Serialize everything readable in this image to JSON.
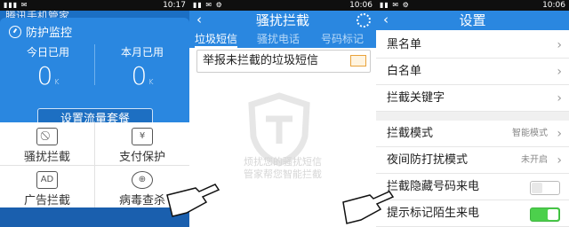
{
  "status": {
    "s1_time": "10:17",
    "s2_time": "10:06",
    "s3_time": "10:06"
  },
  "screen1": {
    "header": "腾讯手机管家",
    "card_title": "防护监控",
    "today_label": "今日已用",
    "today_value": "0",
    "today_unit": "K",
    "month_label": "本月已用",
    "month_value": "0",
    "month_unit": "K",
    "plan_button": "设置流量套餐",
    "grid": [
      {
        "label": "骚扰拦截",
        "icon": "block-icon"
      },
      {
        "label": "支付保护",
        "icon": "yen-shield-icon"
      },
      {
        "label": "广告拦截",
        "icon": "ad-block-icon"
      },
      {
        "label": "病毒查杀",
        "icon": "virus-scan-icon"
      }
    ]
  },
  "screen2": {
    "title": "骚扰拦截",
    "tabs": [
      "垃圾短信",
      "骚扰电话",
      "号码标记"
    ],
    "report_text": "举报未拦截的垃圾短信",
    "empty_line1": "烦扰您的骚扰短信",
    "empty_line2": "管家帮您智能拦截"
  },
  "screen3": {
    "title": "设置",
    "rows": [
      {
        "label": "黑名单"
      },
      {
        "label": "白名单"
      },
      {
        "label": "拦截关键字"
      },
      {
        "label": "拦截模式",
        "value": "智能模式"
      },
      {
        "label": "夜间防打扰模式",
        "value": "未开启"
      },
      {
        "label": "拦截隐藏号码来电",
        "toggle": false
      },
      {
        "label": "提示标记陌生来电",
        "toggle": true
      }
    ]
  },
  "colors": {
    "accent": "#2a87e0",
    "toggle_on": "#4cd04c"
  }
}
